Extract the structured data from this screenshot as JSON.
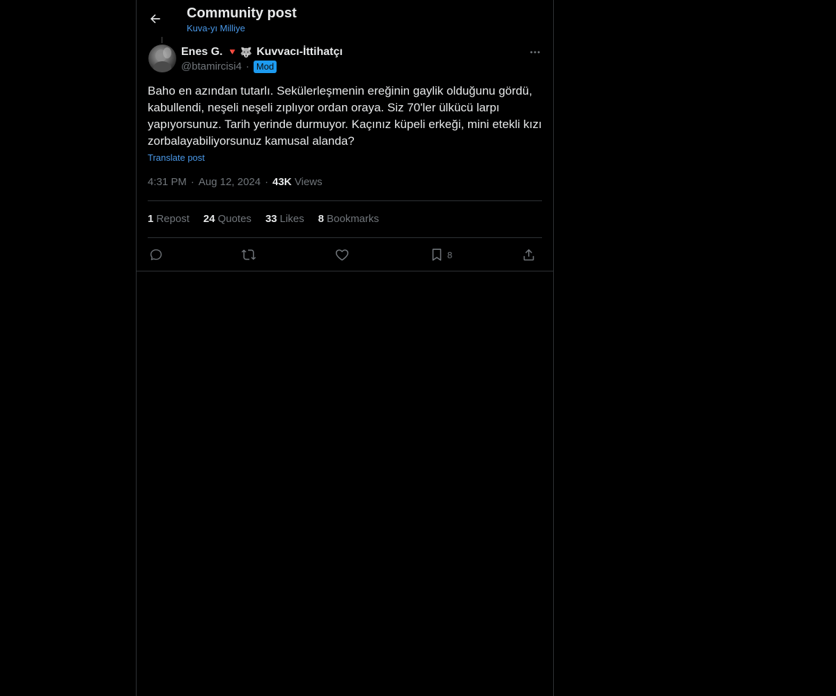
{
  "header": {
    "title": "Community post",
    "community": "Kuva-yı Milliye"
  },
  "author": {
    "name": "Enes G.",
    "name_suffix": "Kuvvacı-İttihatçı",
    "handle": "@btamircisi4",
    "separator": "·",
    "badge": "Mod",
    "emoji_1": "🔻",
    "emoji_2": "🐺"
  },
  "post": {
    "text": "Baho en azından tutarlı. Sekülerleşmenin ereğinin gaylik olduğunu gördü, kabullendi, neşeli neşeli zıplıyor ordan oraya. Siz 70'ler ülkücü larpı yapıyorsunuz. Tarih yerinde durmuyor. Kaçınız küpeli erkeği, mini etekli kızı zorbalayabiliyorsunuz kamusal alanda?",
    "translate_label": "Translate post",
    "time": "4:31 PM",
    "date": "Aug 12, 2024",
    "views_count": "43K",
    "views_label": "Views",
    "dot": "·"
  },
  "stats": [
    {
      "count": "1",
      "label": "Repost"
    },
    {
      "count": "24",
      "label": "Quotes"
    },
    {
      "count": "33",
      "label": "Likes"
    },
    {
      "count": "8",
      "label": "Bookmarks"
    }
  ],
  "actions": {
    "reply_icon": "reply-icon",
    "repost_icon": "repost-icon",
    "like_icon": "heart-icon",
    "bookmark_icon": "bookmark-icon",
    "bookmark_count": "8",
    "share_icon": "share-icon"
  },
  "colors": {
    "background": "#000000",
    "text": "#e7e9ea",
    "muted": "#71767b",
    "link": "#4a99e9",
    "badge": "#1d9bf0",
    "border": "#2f3336"
  }
}
